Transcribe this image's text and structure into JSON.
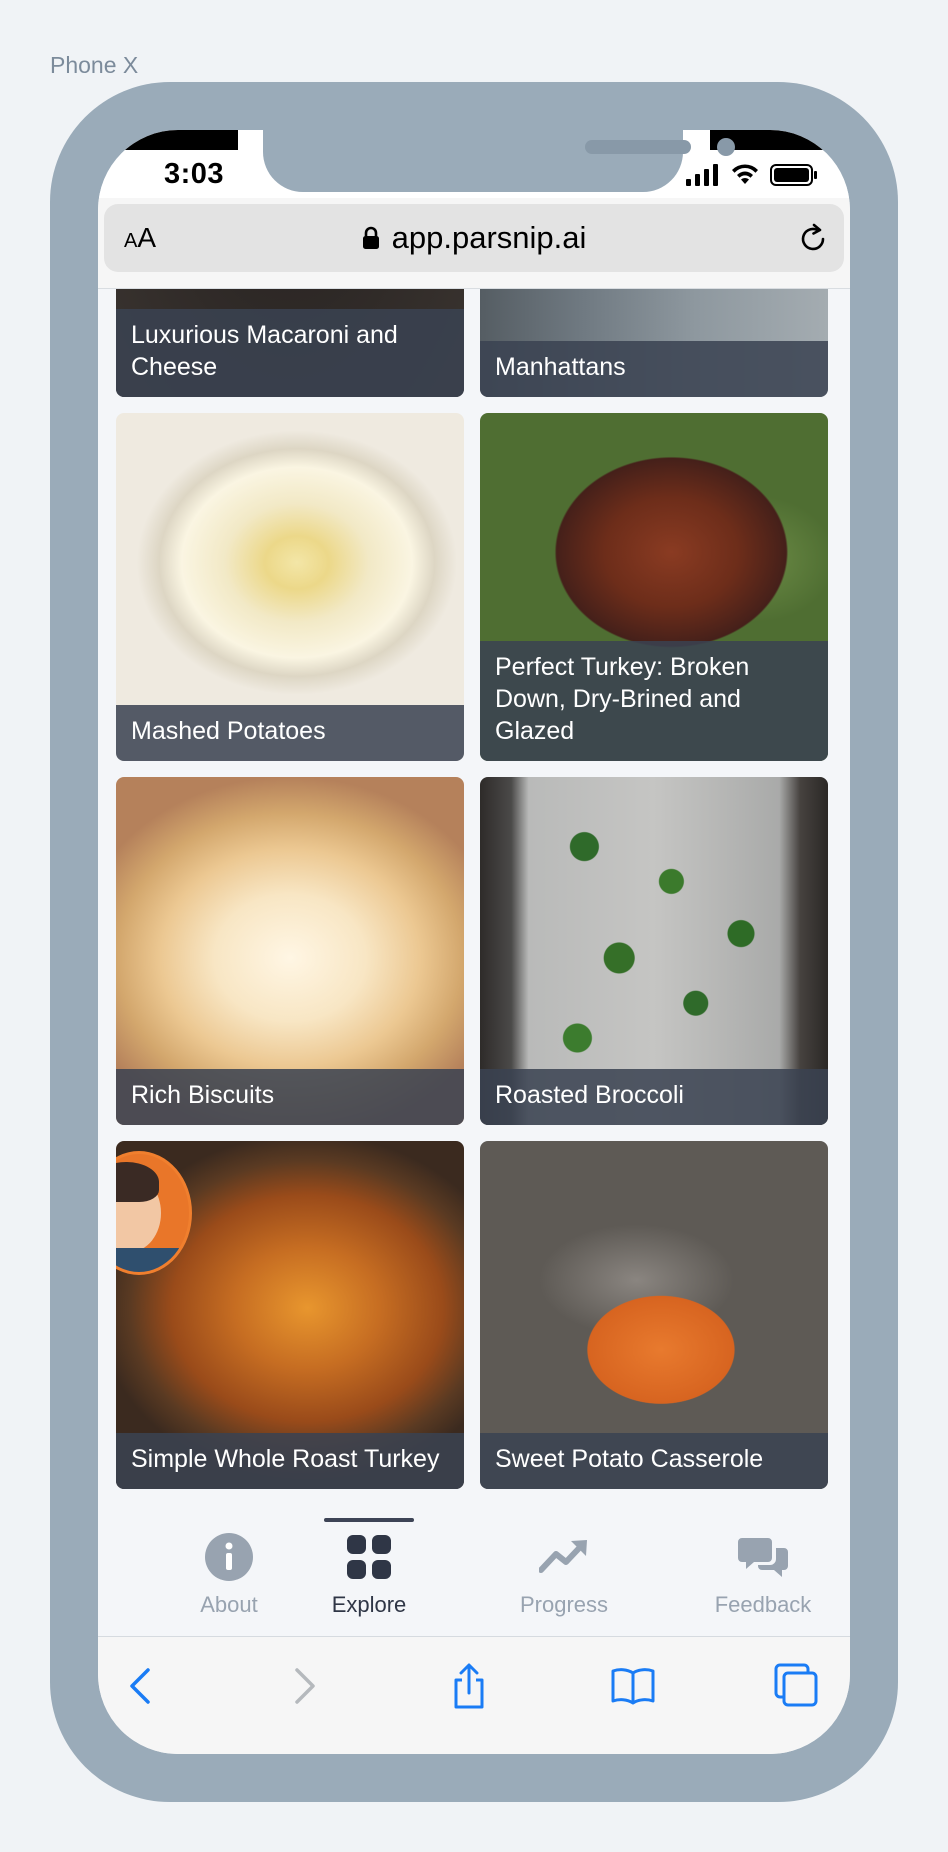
{
  "device_label": "Phone X",
  "status_bar": {
    "time": "3:03"
  },
  "address_bar": {
    "text_size_small": "A",
    "text_size_large": "A",
    "url": "app.parsnip.ai"
  },
  "recipes": [
    {
      "title": "Luxurious Macaroni and Cheese"
    },
    {
      "title": "Manhattans"
    },
    {
      "title": "Mashed Potatoes"
    },
    {
      "title": "Perfect Turkey: Broken Down, Dry-Brined and Glazed"
    },
    {
      "title": "Rich Biscuits"
    },
    {
      "title": "Roasted Broccoli"
    },
    {
      "title": "Simple Whole Roast Turkey"
    },
    {
      "title": "Sweet Potato Casserole"
    }
  ],
  "tabs": [
    {
      "label": "About",
      "icon": "info-icon",
      "active": false
    },
    {
      "label": "Explore",
      "icon": "grid-icon",
      "active": true
    },
    {
      "label": "Progress",
      "icon": "trending-up-icon",
      "active": false
    },
    {
      "label": "Feedback",
      "icon": "chat-bubbles-icon",
      "active": false
    }
  ],
  "browser_toolbar": {
    "icons": [
      "back-icon",
      "forward-icon",
      "share-icon",
      "bookmarks-icon",
      "tabs-icon"
    ]
  },
  "colors": {
    "frame": "#9aabb9",
    "overlay": "#3a4252",
    "accent_blue": "#1a7cf5",
    "tab_active": "#2f3646",
    "tab_inactive": "#98a3b0"
  }
}
